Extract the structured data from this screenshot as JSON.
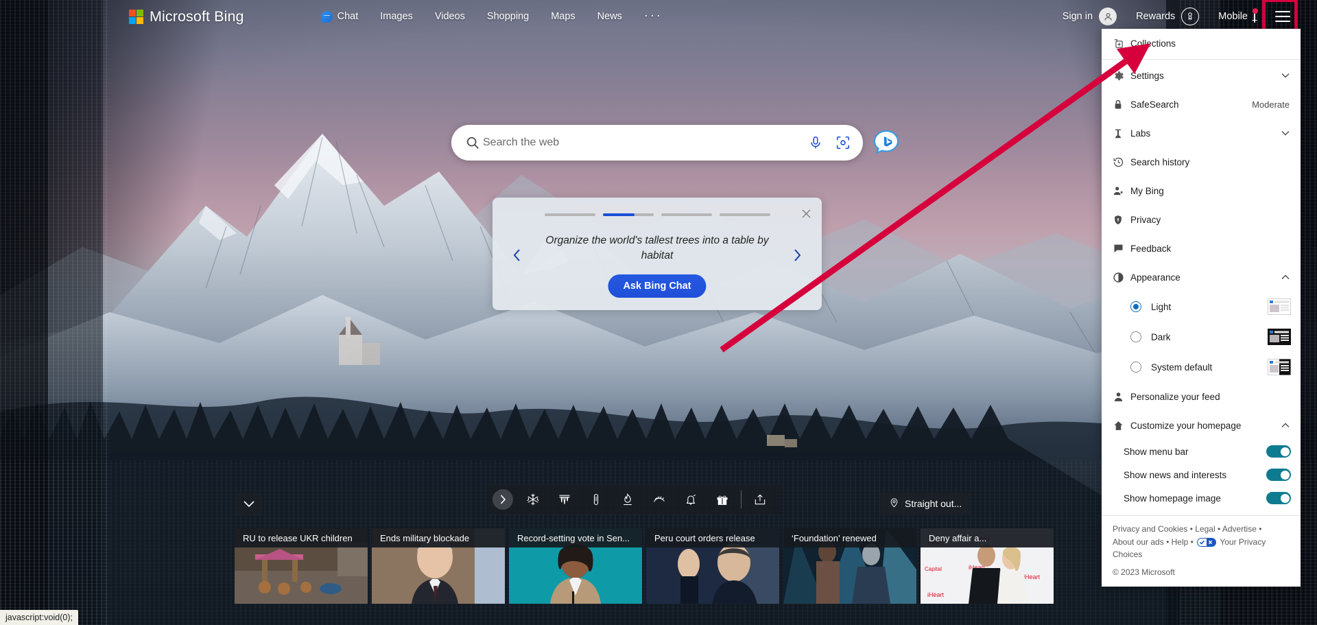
{
  "page": {
    "status_bar_text": "javascript:void(0);"
  },
  "topnav": {
    "brand": "Microsoft Bing",
    "links": [
      {
        "label": "Chat",
        "icon": "bing-chat-icon"
      },
      {
        "label": "Images",
        "icon": ""
      },
      {
        "label": "Videos",
        "icon": ""
      },
      {
        "label": "Shopping",
        "icon": ""
      },
      {
        "label": "Maps",
        "icon": ""
      },
      {
        "label": "News",
        "icon": ""
      },
      {
        "label": "···",
        "icon": "more-icon"
      }
    ],
    "sign_in": "Sign in",
    "rewards": "Rewards",
    "mobile": "Mobile",
    "hamburger_highlight_color": "#d6003c"
  },
  "search": {
    "placeholder": "Search the web",
    "value": "",
    "mic_icon": "microphone-icon",
    "camera_icon": "visual-search-icon",
    "glass_icon": "search-icon"
  },
  "suggestion_card": {
    "text": "Organize the world's tallest trees into a table by habitat",
    "button_label": "Ask Bing Chat",
    "close_icon": "close-icon",
    "prev_icon": "chevron-left-icon",
    "next_icon": "chevron-right-icon",
    "total_dots": 4,
    "active_dot_index": 1
  },
  "icon_strip": {
    "next_icon": "chevron-right-icon",
    "icons": [
      "snowflake-icon",
      "icicles-icon",
      "thermometer-icon",
      "campfire-icon",
      "snow-drift-icon",
      "bell-icon",
      "gift-icon"
    ],
    "share_icon": "share-icon",
    "collapse_icon": "chevron-down-icon",
    "location_icon": "location-pin-icon",
    "location_label": "Straight out..."
  },
  "news": {
    "cards": [
      {
        "title": "RU to release UKR children",
        "tone": "rubble"
      },
      {
        "title": "Ends military blockade",
        "tone": "portrait-warm"
      },
      {
        "title": "Record-setting vote in Sen...",
        "tone": "teal-portrait"
      },
      {
        "title": "Peru court orders release",
        "tone": "navy-portrait"
      },
      {
        "title": "‘Foundation’ renewed",
        "tone": "scifi-blue"
      },
      {
        "title": "Deny affair a...",
        "tone": "red-carpet"
      }
    ]
  },
  "menu": {
    "items": [
      {
        "label": "Collections",
        "icon": "collections-icon",
        "value": "",
        "chevron": ""
      },
      {
        "label": "Settings",
        "icon": "gear-icon",
        "value": "",
        "chevron": "down"
      },
      {
        "label": "SafeSearch",
        "icon": "lock-icon",
        "value": "Moderate",
        "chevron": ""
      },
      {
        "label": "Labs",
        "icon": "labs-flask-icon",
        "value": "",
        "chevron": "down"
      },
      {
        "label": "Search history",
        "icon": "history-icon",
        "value": "",
        "chevron": ""
      },
      {
        "label": "My Bing",
        "icon": "person-star-icon",
        "value": "",
        "chevron": ""
      },
      {
        "label": "Privacy",
        "icon": "shield-icon",
        "value": "",
        "chevron": ""
      },
      {
        "label": "Feedback",
        "icon": "feedback-icon",
        "value": "",
        "chevron": ""
      }
    ],
    "appearance": {
      "label": "Appearance",
      "icon": "contrast-circle-icon",
      "chevron": "up",
      "options": [
        {
          "label": "Light",
          "selected": true
        },
        {
          "label": "Dark",
          "selected": false
        },
        {
          "label": "System default",
          "selected": false
        }
      ]
    },
    "personalize": {
      "label": "Personalize your feed",
      "icon": "person-icon"
    },
    "customize": {
      "label": "Customize your homepage",
      "icon": "home-icon",
      "chevron": "up",
      "toggles": [
        {
          "label": "Show menu bar",
          "on": true
        },
        {
          "label": "Show news and interests",
          "on": true
        },
        {
          "label": "Show homepage image",
          "on": true
        }
      ]
    },
    "footer": {
      "links_line1": [
        "Privacy and Cookies",
        "Legal",
        "Advertise"
      ],
      "links_line2": [
        "About our ads",
        "Help"
      ],
      "privacy_choices": "Your Privacy Choices",
      "privacy_choices_icon": "privacy-choices-icon",
      "copyright": "© 2023 Microsoft",
      "separator": "•"
    }
  },
  "colors": {
    "accent_blue": "#1a4fd6",
    "toggle_teal": "#0f7b91",
    "radio_blue": "#0f6cbd",
    "annotation_red": "#d6003c"
  }
}
